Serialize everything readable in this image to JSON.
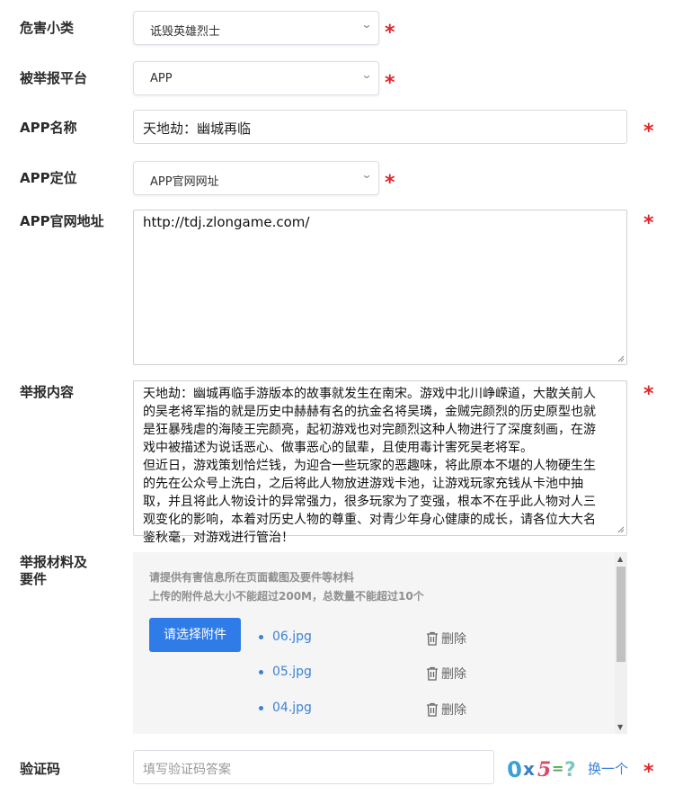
{
  "form": {
    "hazard_subtype": {
      "label": "危害小类",
      "value": "诋毁英雄烈士"
    },
    "platform": {
      "label": "被举报平台",
      "value": "APP"
    },
    "app_name": {
      "label": "APP名称",
      "value": "天地劫：幽城再临"
    },
    "app_position": {
      "label": "APP定位",
      "value": "APP官网网址"
    },
    "app_url": {
      "label": "APP官网地址",
      "value": "http://tdj.zlongame.com/"
    },
    "report_content": {
      "label": "举报内容",
      "value": "天地劫：幽城再临手游版本的故事就发生在南宋。游戏中北川峥嵘道，大散关前人\n的吴老将军指的就是历史中赫赫有名的抗金名将吴璘，金贼完颜烈的历史原型也就\n是狂暴残虐的海陵王完颜亮，起初游戏也对完颜烈这种人物进行了深度刻画，在游\n戏中被描述为说话恶心、做事恶心的鼠辈，且使用毒计害死吴老将军。\n但近日，游戏策划恰烂钱，为迎合一些玩家的恶趣味，将此原本不堪的人物硬生生\n的先在公众号上洗白，之后将此人物放进游戏卡池，让游戏玩家充钱从卡池中抽\n取，并且将此人物设计的异常强力，很多玩家为了变强，根本不在乎此人物对人三\n观变化的影响，本着对历史人物的尊重、对青少年身心健康的成长，请各位大大名\n鉴秋毫，对游戏进行管治！"
    },
    "attachments": {
      "label_line1": "举报材料及",
      "label_line2": "要件",
      "hint1": "请提供有害信息所在页面截图及要件等材料",
      "hint2": "上传的附件总大小不能超过200M，总数量不能超过10个",
      "button_label": "请选择附件",
      "delete_label": "删除",
      "files": [
        "06.jpg",
        "05.jpg",
        "04.jpg"
      ]
    },
    "captcha": {
      "label": "验证码",
      "placeholder": "填写验证码答案",
      "image_text": "0x5=?",
      "refresh_label": "换一个"
    },
    "required_mark": "*"
  },
  "colors": {
    "accent": "#2f7be8",
    "link": "#3b82d6",
    "required": "#e0242a"
  }
}
